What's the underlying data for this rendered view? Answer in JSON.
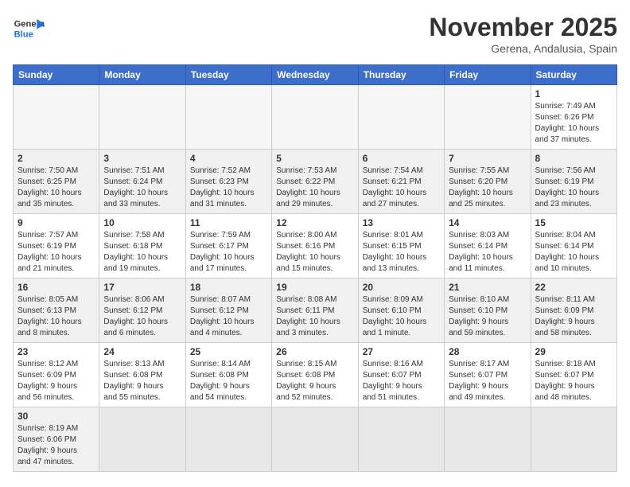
{
  "header": {
    "logo_general": "General",
    "logo_blue": "Blue",
    "month_title": "November 2025",
    "subtitle": "Gerena, Andalusia, Spain"
  },
  "days_of_week": [
    "Sunday",
    "Monday",
    "Tuesday",
    "Wednesday",
    "Thursday",
    "Friday",
    "Saturday"
  ],
  "weeks": [
    [
      {
        "day": "",
        "info": "",
        "empty": true
      },
      {
        "day": "",
        "info": "",
        "empty": true
      },
      {
        "day": "",
        "info": "",
        "empty": true
      },
      {
        "day": "",
        "info": "",
        "empty": true
      },
      {
        "day": "",
        "info": "",
        "empty": true
      },
      {
        "day": "",
        "info": "",
        "empty": true
      },
      {
        "day": "1",
        "info": "Sunrise: 7:49 AM\nSunset: 6:26 PM\nDaylight: 10 hours\nand 37 minutes."
      }
    ],
    [
      {
        "day": "2",
        "info": "Sunrise: 7:50 AM\nSunset: 6:25 PM\nDaylight: 10 hours\nand 35 minutes."
      },
      {
        "day": "3",
        "info": "Sunrise: 7:51 AM\nSunset: 6:24 PM\nDaylight: 10 hours\nand 33 minutes."
      },
      {
        "day": "4",
        "info": "Sunrise: 7:52 AM\nSunset: 6:23 PM\nDaylight: 10 hours\nand 31 minutes."
      },
      {
        "day": "5",
        "info": "Sunrise: 7:53 AM\nSunset: 6:22 PM\nDaylight: 10 hours\nand 29 minutes."
      },
      {
        "day": "6",
        "info": "Sunrise: 7:54 AM\nSunset: 6:21 PM\nDaylight: 10 hours\nand 27 minutes."
      },
      {
        "day": "7",
        "info": "Sunrise: 7:55 AM\nSunset: 6:20 PM\nDaylight: 10 hours\nand 25 minutes."
      },
      {
        "day": "8",
        "info": "Sunrise: 7:56 AM\nSunset: 6:19 PM\nDaylight: 10 hours\nand 23 minutes."
      }
    ],
    [
      {
        "day": "9",
        "info": "Sunrise: 7:57 AM\nSunset: 6:19 PM\nDaylight: 10 hours\nand 21 minutes."
      },
      {
        "day": "10",
        "info": "Sunrise: 7:58 AM\nSunset: 6:18 PM\nDaylight: 10 hours\nand 19 minutes."
      },
      {
        "day": "11",
        "info": "Sunrise: 7:59 AM\nSunset: 6:17 PM\nDaylight: 10 hours\nand 17 minutes."
      },
      {
        "day": "12",
        "info": "Sunrise: 8:00 AM\nSunset: 6:16 PM\nDaylight: 10 hours\nand 15 minutes."
      },
      {
        "day": "13",
        "info": "Sunrise: 8:01 AM\nSunset: 6:15 PM\nDaylight: 10 hours\nand 13 minutes."
      },
      {
        "day": "14",
        "info": "Sunrise: 8:03 AM\nSunset: 6:14 PM\nDaylight: 10 hours\nand 11 minutes."
      },
      {
        "day": "15",
        "info": "Sunrise: 8:04 AM\nSunset: 6:14 PM\nDaylight: 10 hours\nand 10 minutes."
      }
    ],
    [
      {
        "day": "16",
        "info": "Sunrise: 8:05 AM\nSunset: 6:13 PM\nDaylight: 10 hours\nand 8 minutes."
      },
      {
        "day": "17",
        "info": "Sunrise: 8:06 AM\nSunset: 6:12 PM\nDaylight: 10 hours\nand 6 minutes."
      },
      {
        "day": "18",
        "info": "Sunrise: 8:07 AM\nSunset: 6:12 PM\nDaylight: 10 hours\nand 4 minutes."
      },
      {
        "day": "19",
        "info": "Sunrise: 8:08 AM\nSunset: 6:11 PM\nDaylight: 10 hours\nand 3 minutes."
      },
      {
        "day": "20",
        "info": "Sunrise: 8:09 AM\nSunset: 6:10 PM\nDaylight: 10 hours\nand 1 minute."
      },
      {
        "day": "21",
        "info": "Sunrise: 8:10 AM\nSunset: 6:10 PM\nDaylight: 9 hours\nand 59 minutes."
      },
      {
        "day": "22",
        "info": "Sunrise: 8:11 AM\nSunset: 6:09 PM\nDaylight: 9 hours\nand 58 minutes."
      }
    ],
    [
      {
        "day": "23",
        "info": "Sunrise: 8:12 AM\nSunset: 6:09 PM\nDaylight: 9 hours\nand 56 minutes."
      },
      {
        "day": "24",
        "info": "Sunrise: 8:13 AM\nSunset: 6:08 PM\nDaylight: 9 hours\nand 55 minutes."
      },
      {
        "day": "25",
        "info": "Sunrise: 8:14 AM\nSunset: 6:08 PM\nDaylight: 9 hours\nand 54 minutes."
      },
      {
        "day": "26",
        "info": "Sunrise: 8:15 AM\nSunset: 6:08 PM\nDaylight: 9 hours\nand 52 minutes."
      },
      {
        "day": "27",
        "info": "Sunrise: 8:16 AM\nSunset: 6:07 PM\nDaylight: 9 hours\nand 51 minutes."
      },
      {
        "day": "28",
        "info": "Sunrise: 8:17 AM\nSunset: 6:07 PM\nDaylight: 9 hours\nand 49 minutes."
      },
      {
        "day": "29",
        "info": "Sunrise: 8:18 AM\nSunset: 6:07 PM\nDaylight: 9 hours\nand 48 minutes."
      }
    ],
    [
      {
        "day": "30",
        "info": "Sunrise: 8:19 AM\nSunset: 6:06 PM\nDaylight: 9 hours\nand 47 minutes."
      },
      {
        "day": "",
        "info": "",
        "empty": true
      },
      {
        "day": "",
        "info": "",
        "empty": true
      },
      {
        "day": "",
        "info": "",
        "empty": true
      },
      {
        "day": "",
        "info": "",
        "empty": true
      },
      {
        "day": "",
        "info": "",
        "empty": true
      },
      {
        "day": "",
        "info": "",
        "empty": true
      }
    ]
  ],
  "colors": {
    "header_bg": "#3d6ecc",
    "shaded_row_bg": "#f0f0f0",
    "empty_bg": "#f5f5f5"
  }
}
